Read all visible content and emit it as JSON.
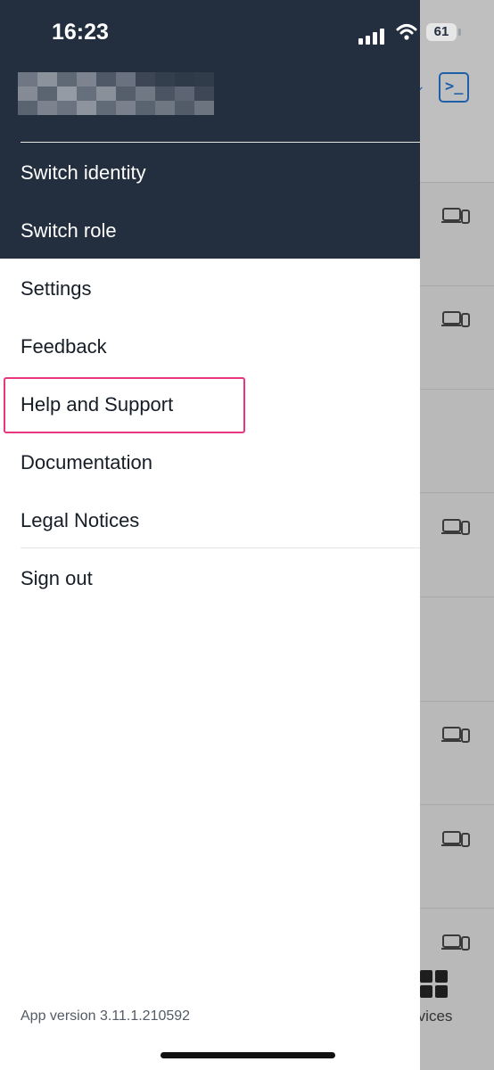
{
  "status_bar": {
    "time": "16:23",
    "battery": "61"
  },
  "drawer": {
    "header_items": [
      {
        "label": "Switch identity"
      },
      {
        "label": "Switch role"
      }
    ],
    "menu_items": [
      {
        "label": "Settings"
      },
      {
        "label": "Feedback"
      },
      {
        "label": "Help and Support"
      },
      {
        "label": "Documentation"
      },
      {
        "label": "Legal Notices"
      },
      {
        "label": "Sign out"
      }
    ],
    "app_version": "App version 3.11.1.210592"
  },
  "background_app": {
    "terminal_symbol": ">_",
    "tab_services_label": "rvices"
  },
  "colors": {
    "drawer_header": "#232f3e",
    "highlight": "#e8377e",
    "accent": "#1f5fa8"
  }
}
